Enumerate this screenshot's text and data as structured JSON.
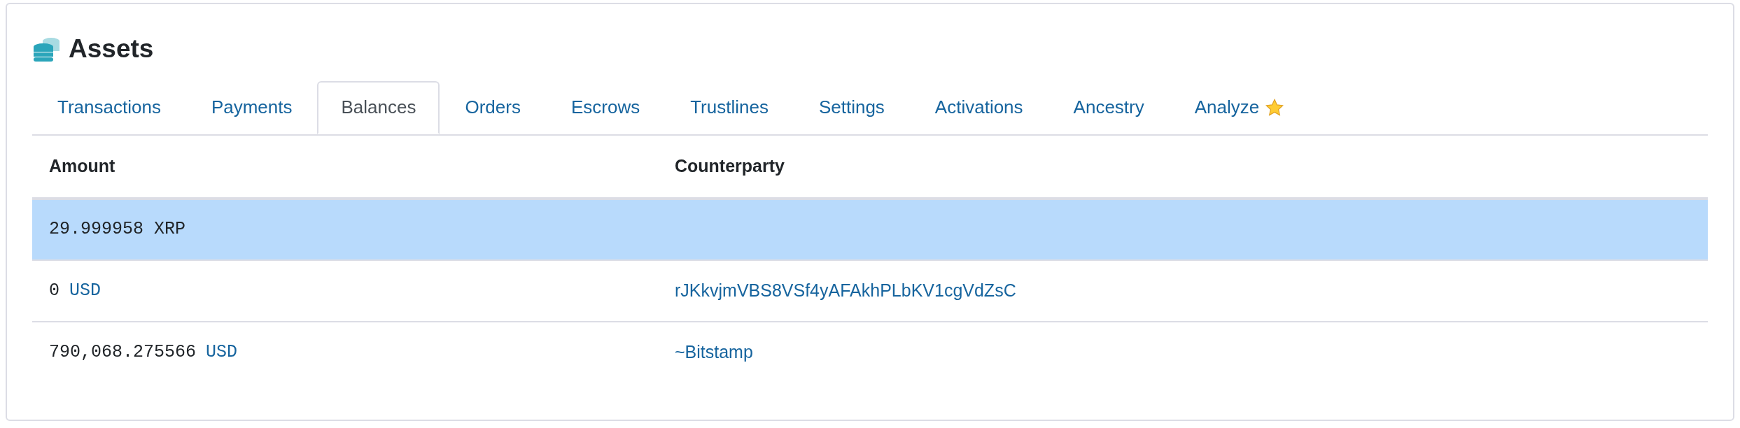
{
  "title": "Assets",
  "tabs": [
    {
      "label": "Transactions",
      "selected": false
    },
    {
      "label": "Payments",
      "selected": false
    },
    {
      "label": "Balances",
      "selected": true
    },
    {
      "label": "Orders",
      "selected": false
    },
    {
      "label": "Escrows",
      "selected": false
    },
    {
      "label": "Trustlines",
      "selected": false
    },
    {
      "label": "Settings",
      "selected": false
    },
    {
      "label": "Activations",
      "selected": false
    },
    {
      "label": "Ancestry",
      "selected": false
    },
    {
      "label": "Analyze",
      "selected": false,
      "starred": true
    }
  ],
  "table": {
    "columns": [
      "Amount",
      "Counterparty"
    ],
    "rows": [
      {
        "amount": "29.999958 XRP",
        "selected": true
      },
      {
        "amount": "0",
        "currency": "USD",
        "counterparty": "rJKkvjmVBS8VSf4yAFAkhPLbKV1cgVdZsC",
        "selected": false
      },
      {
        "amount": "790,068.275566",
        "currency": "USD",
        "counterparty": "~Bitstamp",
        "selected": false
      }
    ]
  }
}
